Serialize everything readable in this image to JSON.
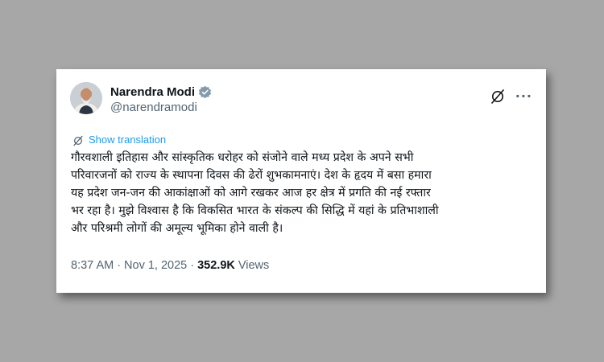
{
  "post": {
    "author": {
      "display_name": "Narendra Modi",
      "handle": "@narendramodi",
      "verified": true,
      "verified_badge_color": "#829aab"
    },
    "actions": {
      "grok_icon": "grok-icon",
      "more_label": "···"
    },
    "translation": {
      "label": "Show translation",
      "icon": "grok-icon"
    },
    "text": "गौरवशाली इतिहास और सांस्कृतिक धरोहर को संजोने वाले मध्य प्रदेश के अपने सभी\nपरिवारजनों को राज्य के स्थापना दिवस की ढेरों शुभकामनाएं। देश के हृदय में बसा हमारा\nयह प्रदेश जन-जन की आकांक्षाओं को आगे रखकर आज हर क्षेत्र में प्रगति की नई रफ्तार\nभर रहा है। मुझे विश्वास है कि विकसित भारत के संकल्प की सिद्धि में यहां के प्रतिभाशाली\nऔर परिश्रमी लोगों की अमूल्य भूमिका होने वाली है।",
    "meta": {
      "time": "8:37 AM",
      "separator": "·",
      "date": "Nov 1, 2025",
      "views_count": "352.9K",
      "views_label": "Views"
    }
  },
  "colors": {
    "background": "#a7a7a7",
    "card": "#ffffff",
    "link": "#1d9bf0",
    "text": "#0f1419",
    "muted": "#536471"
  }
}
